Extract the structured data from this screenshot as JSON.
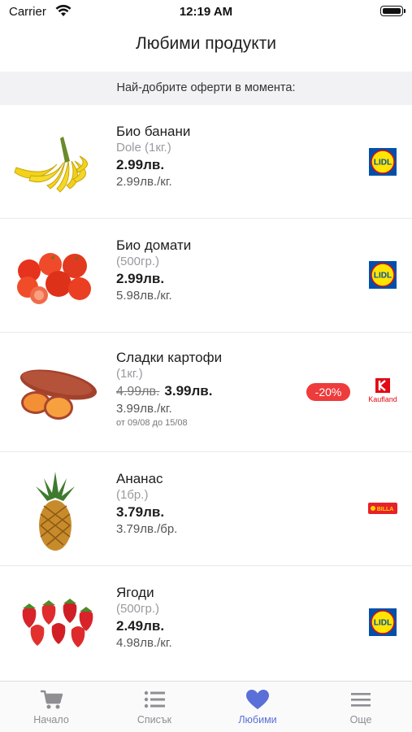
{
  "status_bar": {
    "carrier": "Carrier",
    "time": "12:19 AM"
  },
  "nav": {
    "title": "Любими продукти"
  },
  "banner": {
    "text": "Най-добрите оферти в момента:"
  },
  "products": [
    {
      "name": "Био банани",
      "sub": "Dole (1кг.)",
      "price": "2.99лв.",
      "unit_price": "2.99лв./кг.",
      "store": "Lidl",
      "image": "bananas"
    },
    {
      "name": "Био домати",
      "sub": "(500гр.)",
      "price": "2.99лв.",
      "unit_price": "5.98лв./кг.",
      "store": "Lidl",
      "image": "tomatoes"
    },
    {
      "name": "Сладки картофи",
      "sub": "(1кг.)",
      "old_price": "4.99лв.",
      "price": "3.99лв.",
      "unit_price": "3.99лв./кг.",
      "dates": "от 09/08 до 15/08",
      "discount": "-20%",
      "store": "Kaufland",
      "image": "sweet-potato"
    },
    {
      "name": "Ананас",
      "sub": "(1бр.)",
      "price": "3.79лв.",
      "unit_price": "3.79лв./бр.",
      "store": "Billa",
      "image": "pineapple"
    },
    {
      "name": "Ягоди",
      "sub": "(500гр.)",
      "price": "2.49лв.",
      "unit_price": "4.98лв./кг.",
      "store": "Lidl",
      "image": "strawberries"
    }
  ],
  "store_logos": {
    "lidl_text": "LIDL",
    "kaufland_text": "Kaufland",
    "billa_text": "BILLA"
  },
  "tabs": [
    {
      "label": "Начало",
      "icon": "cart-icon"
    },
    {
      "label": "Списък",
      "icon": "list-icon"
    },
    {
      "label": "Любими",
      "icon": "heart-icon",
      "active": true
    },
    {
      "label": "Още",
      "icon": "menu-icon"
    }
  ],
  "colors": {
    "accent": "#5b6fd8",
    "discount": "#ee3b3b",
    "lidl_blue": "#0050aa",
    "lidl_yellow": "#ffe500",
    "kaufland_red": "#e10915"
  }
}
